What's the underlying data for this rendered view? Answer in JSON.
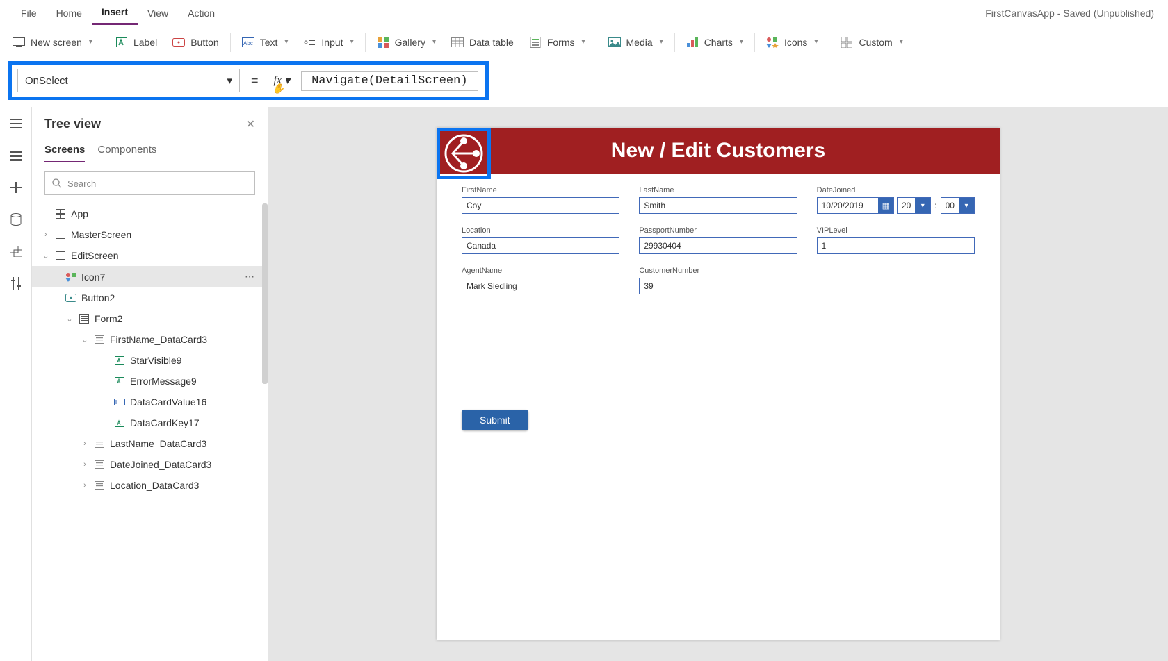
{
  "app_title": "FirstCanvasApp - Saved (Unpublished)",
  "menu": {
    "file": "File",
    "home": "Home",
    "insert": "Insert",
    "view": "View",
    "action": "Action"
  },
  "ribbon": {
    "new_screen": "New screen",
    "label": "Label",
    "button": "Button",
    "text": "Text",
    "input": "Input",
    "gallery": "Gallery",
    "data_table": "Data table",
    "forms": "Forms",
    "media": "Media",
    "charts": "Charts",
    "icons": "Icons",
    "custom": "Custom"
  },
  "formula": {
    "property": "OnSelect",
    "fx": "fx",
    "value": "Navigate(DetailScreen)"
  },
  "tree": {
    "title": "Tree view",
    "tabs": {
      "screens": "Screens",
      "components": "Components"
    },
    "search_placeholder": "Search",
    "nodes": {
      "app": "App",
      "master": "MasterScreen",
      "edit": "EditScreen",
      "icon7": "Icon7",
      "button2": "Button2",
      "form2": "Form2",
      "firstname_dc": "FirstName_DataCard3",
      "starvisible9": "StarVisible9",
      "errormessage9": "ErrorMessage9",
      "datacardvalue16": "DataCardValue16",
      "datacardkey17": "DataCardKey17",
      "lastname_dc": "LastName_DataCard3",
      "datejoined_dc": "DateJoined_DataCard3",
      "location_dc": "Location_DataCard3"
    }
  },
  "screen": {
    "title": "New / Edit Customers",
    "fields": {
      "firstname": {
        "label": "FirstName",
        "value": "Coy"
      },
      "lastname": {
        "label": "LastName",
        "value": "Smith"
      },
      "datejoined": {
        "label": "DateJoined",
        "value": "10/20/2019",
        "hour": "20",
        "minute": "00"
      },
      "location": {
        "label": "Location",
        "value": "Canada"
      },
      "passport": {
        "label": "PassportNumber",
        "value": "29930404"
      },
      "viplevel": {
        "label": "VIPLevel",
        "value": "1"
      },
      "agentname": {
        "label": "AgentName",
        "value": "Mark Siedling"
      },
      "customernumber": {
        "label": "CustomerNumber",
        "value": "39"
      }
    },
    "submit": "Submit"
  }
}
